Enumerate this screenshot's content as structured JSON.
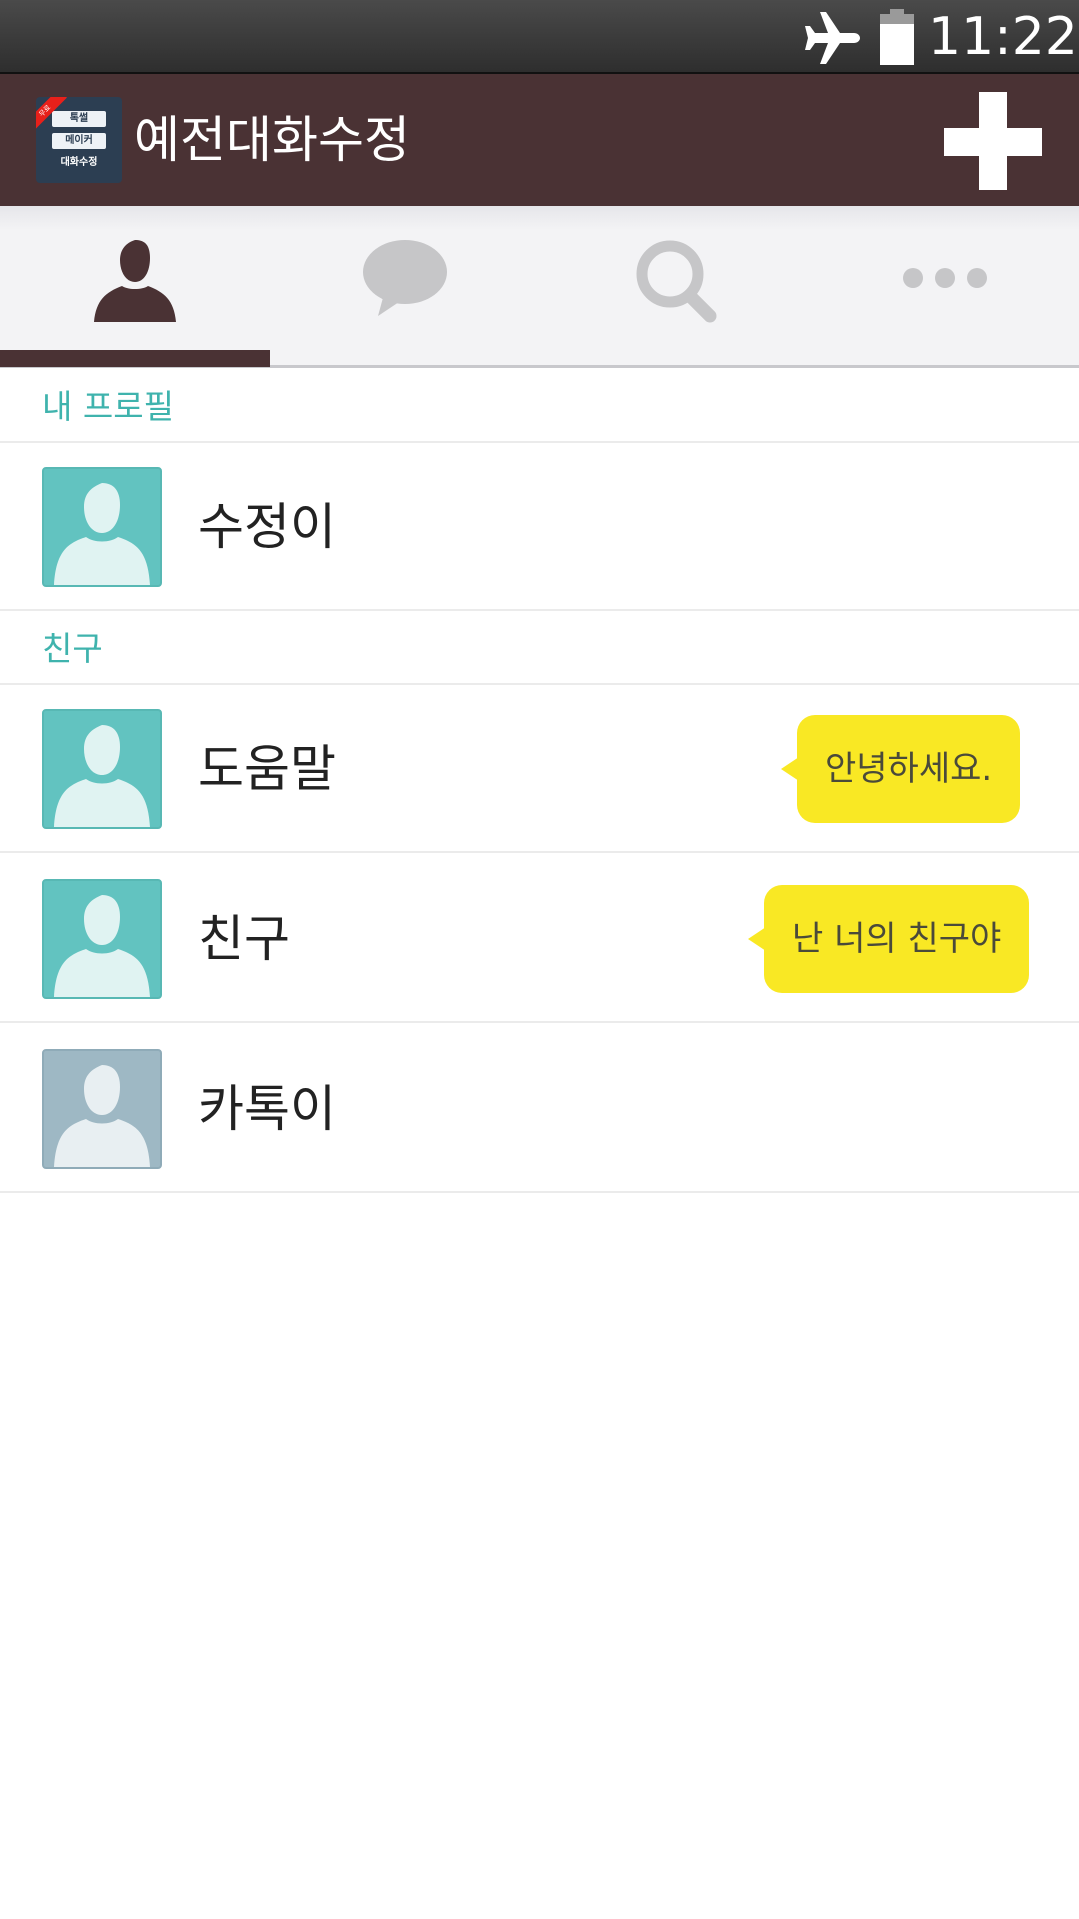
{
  "status_bar": {
    "time": "11:22",
    "icons": [
      "airplane-mode-icon",
      "battery-icon"
    ]
  },
  "app_bar": {
    "title": "예전대화수정",
    "logo": {
      "ribbon": "무료",
      "line1": "톡썰",
      "line2": "메이커",
      "line3": "대화수정"
    },
    "add_icon": "plus-icon"
  },
  "tabs": [
    {
      "icon": "friends-person-icon",
      "active": true
    },
    {
      "icon": "chat-bubble-icon",
      "active": false
    },
    {
      "icon": "search-icon",
      "active": false
    },
    {
      "icon": "more-dots-icon",
      "active": false
    }
  ],
  "sections": {
    "my_profile": "내 프로필",
    "friends": "친구"
  },
  "my_profile": {
    "name": "수정이"
  },
  "friends": [
    {
      "name": "도움말",
      "status_message": "안녕하세요."
    },
    {
      "name": "친구",
      "status_message": "난 너의 친구야"
    },
    {
      "name": "카톡이",
      "status_message": ""
    }
  ],
  "colors": {
    "app_bar": "#4a3234",
    "section_label": "#3fb3ad",
    "avatar_teal": "#62c3c0",
    "avatar_grey": "#9eb8c4",
    "bubble": "#f9e824"
  }
}
